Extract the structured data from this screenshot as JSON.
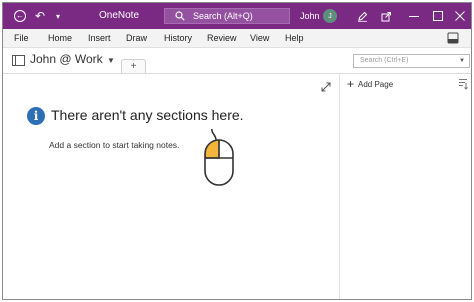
{
  "titlebar": {
    "app_name": "OneNote",
    "search_label": "Search (Alt+Q)",
    "user_name": "John",
    "user_initial": "J",
    "color": "#7b2a84"
  },
  "menu": {
    "items": [
      "File",
      "Home",
      "Insert",
      "Draw",
      "History",
      "Review",
      "View",
      "Help"
    ]
  },
  "notebook": {
    "name": "John @ Work",
    "add_tab_label": "+"
  },
  "page_search": {
    "placeholder": "Search (Ctrl+E)"
  },
  "empty_state": {
    "title": "There aren't any sections here.",
    "subtitle": "Add a section to start taking notes.",
    "info_glyph": "i"
  },
  "page_pane": {
    "add_page_label": "Add Page"
  },
  "icons": {
    "back": "back-icon",
    "undo": "undo-icon",
    "qat": "customize-qat-icon",
    "search": "search-icon",
    "pen": "pen-icon",
    "share": "share-icon",
    "minimize": "minimize-icon",
    "maximize": "maximize-icon",
    "close": "close-icon",
    "ribbon": "ribbon-toggle-icon",
    "expand": "expand-icon",
    "mouse": "mouse-icon",
    "sort": "sort-icon"
  }
}
